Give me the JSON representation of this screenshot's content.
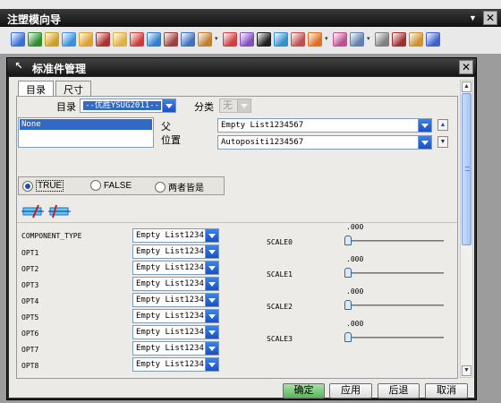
{
  "toolbar_window": {
    "title": "注塑模向导",
    "icons": [
      {
        "name": "mold-init-icon",
        "color": "#3a6fd8"
      },
      {
        "name": "mold-csys-icon",
        "color": "#2f8f2f"
      },
      {
        "name": "shrinkage-icon",
        "color": "#d0a020"
      },
      {
        "name": "workpiece-icon",
        "color": "#3c8fe0"
      },
      {
        "name": "cavity-layout-icon",
        "color": "#e0a030"
      },
      {
        "name": "mold-tools-icon",
        "color": "#b03030"
      },
      {
        "name": "parting-icon",
        "color": "#e0b040"
      },
      {
        "name": "mold-base-icon",
        "color": "#d03c3c"
      },
      {
        "name": "standard-part-icon",
        "color": "#3080d0"
      },
      {
        "name": "ejector-pin-icon",
        "color": "#a04040"
      },
      {
        "name": "slider-icon",
        "color": "#4070c0"
      },
      {
        "name": "insert-icon",
        "color": "#c08030"
      },
      {
        "name": "gate-icon",
        "color": "#d04040"
      },
      {
        "name": "runner-icon",
        "color": "#8050c0"
      },
      {
        "name": "cooling-icon",
        "color": "#202020"
      },
      {
        "name": "electrode-icon",
        "color": "#3090d0"
      },
      {
        "name": "trim-icon",
        "color": "#c05050"
      },
      {
        "name": "pocket-icon",
        "color": "#e07020"
      },
      {
        "name": "bom-icon",
        "color": "#c05090"
      },
      {
        "name": "drawing-icon",
        "color": "#6080b0"
      },
      {
        "name": "hole-table-icon",
        "color": "#808080"
      },
      {
        "name": "view-manager-icon",
        "color": "#a03030"
      },
      {
        "name": "unused-parts-icon",
        "color": "#d09030"
      },
      {
        "name": "cast-process-icon",
        "color": "#4060d0"
      }
    ]
  },
  "dialog": {
    "title": "标准件管理",
    "tabs": [
      {
        "label": "目录",
        "active": true
      },
      {
        "label": "尺寸",
        "active": false
      }
    ],
    "catalog_label": "目录",
    "catalog_value": "--优胜YSUG2011--",
    "category_label": "分类",
    "category_value": "无",
    "list_items": [
      "None"
    ],
    "parent_label": "父",
    "parent_value": "Empty List1234567",
    "position_label": "位置",
    "position_value": "Autopositi1234567",
    "radios": [
      {
        "label": "TRUE",
        "selected": true
      },
      {
        "label": "FALSE",
        "selected": false
      },
      {
        "label": "两者皆是",
        "selected": false
      }
    ],
    "component_rows": [
      {
        "label": "COMPONENT_TYPE",
        "value": "Empty List1234"
      },
      {
        "label": "OPT1",
        "value": "Empty List1234"
      },
      {
        "label": "OPT2",
        "value": "Empty List1234"
      },
      {
        "label": "OPT3",
        "value": "Empty List1234"
      },
      {
        "label": "OPT4",
        "value": "Empty List1234"
      },
      {
        "label": "OPT5",
        "value": "Empty List1234"
      },
      {
        "label": "OPT6",
        "value": "Empty List1234"
      },
      {
        "label": "OPT7",
        "value": "Empty List1234"
      },
      {
        "label": "OPT8",
        "value": "Empty List1234"
      }
    ],
    "scales": [
      {
        "label": "SCALE0",
        "value": ".000"
      },
      {
        "label": "SCALE1",
        "value": ".000"
      },
      {
        "label": "SCALE2",
        "value": ".000"
      },
      {
        "label": "SCALE3",
        "value": ".000"
      }
    ],
    "buttons": {
      "ok": "确定",
      "apply": "应用",
      "back": "后退",
      "cancel": "取消"
    }
  }
}
